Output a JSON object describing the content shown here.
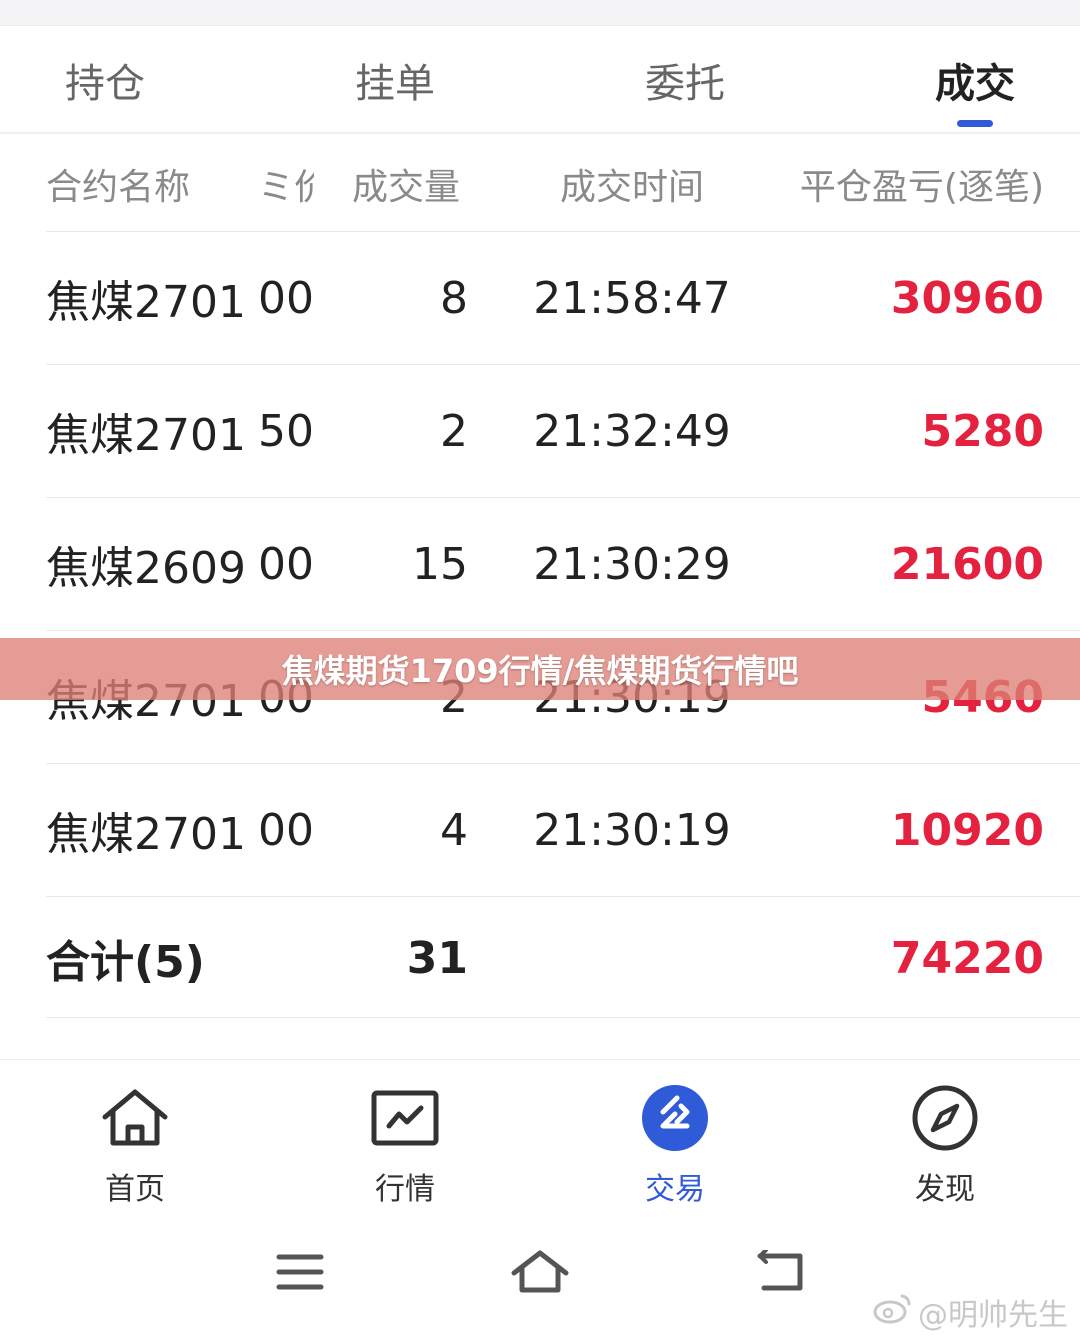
{
  "tabs": [
    {
      "label": "持仓"
    },
    {
      "label": "挂单"
    },
    {
      "label": "委托"
    },
    {
      "label": "成交",
      "active": true
    }
  ],
  "table": {
    "headers": {
      "name": "合约名称",
      "price": "ミ价",
      "qty": "成交量",
      "time": "成交时间",
      "pnl": "平仓盈亏(逐笔)"
    },
    "rows": [
      {
        "name": "焦煤2701",
        "price": "00",
        "qty": "8",
        "time": "21:58:47",
        "pnl": "30960"
      },
      {
        "name": "焦煤2701",
        "price": "50",
        "qty": "2",
        "time": "21:32:49",
        "pnl": "5280"
      },
      {
        "name": "焦煤2609",
        "price": "00",
        "qty": "15",
        "time": "21:30:29",
        "pnl": "21600"
      },
      {
        "name": "焦煤2701",
        "price": "00",
        "qty": "2",
        "time": "21:30:19",
        "pnl": "5460"
      },
      {
        "name": "焦煤2701",
        "price": "00",
        "qty": "4",
        "time": "21:30:19",
        "pnl": "10920"
      }
    ],
    "total": {
      "label": "合计(5)",
      "qty": "31",
      "pnl": "74220"
    }
  },
  "banner": {
    "text": "焦煤期货1709行情/焦煤期货行情吧"
  },
  "nav": [
    {
      "label": "首页",
      "icon": "home-icon"
    },
    {
      "label": "行情",
      "icon": "chart-icon"
    },
    {
      "label": "交易",
      "icon": "trade-icon",
      "active": true
    },
    {
      "label": "发现",
      "icon": "compass-icon"
    }
  ],
  "watermark": {
    "text": "@明帅先生"
  },
  "colors": {
    "accent": "#2f5bd8",
    "profit": "#e4213e"
  }
}
